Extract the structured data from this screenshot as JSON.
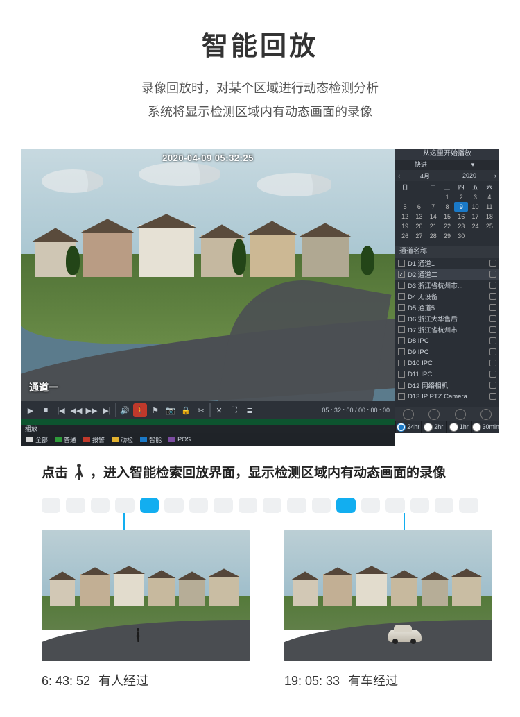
{
  "title": "智能回放",
  "subtitle_line1": "录像回放时，对某个区域进行动态检测分析",
  "subtitle_line2": "系统将显示检测区域内有动态画面的录像",
  "player": {
    "timestamp": "2020-04-09 05:32:25",
    "channel_overlay_label": "通道一",
    "playback_status": "播放",
    "time_readout": "05 : 32 : 00 / 00 : 00 : 00",
    "legend": {
      "all": "全部",
      "normal": "普通",
      "alarm": "报警",
      "motion": "动检",
      "smart": "智能",
      "pos": "POS"
    },
    "legend_colors": {
      "all": "#d8d8d8",
      "normal": "#2e9a3a",
      "alarm": "#c0392b",
      "motion": "#e3b22f",
      "smart": "#1a79c7",
      "pos": "#7b4ca0"
    }
  },
  "side_panel": {
    "header": "从这里开始播放",
    "tab_fast": "快进",
    "month_nav": {
      "prev": "‹",
      "month_label": "4月",
      "year_label": "2020",
      "next": "›"
    },
    "calendar": {
      "weekday_headers": [
        "日",
        "一",
        "二",
        "三",
        "四",
        "五",
        "六"
      ],
      "rows": [
        [
          "",
          "",
          "",
          "1",
          "2",
          "3",
          "4"
        ],
        [
          "5",
          "6",
          "7",
          "8",
          "9",
          "10",
          "11"
        ],
        [
          "12",
          "13",
          "14",
          "15",
          "16",
          "17",
          "18"
        ],
        [
          "19",
          "20",
          "21",
          "22",
          "23",
          "24",
          "25"
        ],
        [
          "26",
          "27",
          "28",
          "29",
          "30",
          "",
          ""
        ]
      ],
      "today": "9"
    },
    "channel_header": "通道名称",
    "channels": [
      {
        "id": "D1",
        "label": "D1 通道1",
        "checked": false
      },
      {
        "id": "D2",
        "label": "D2 通道二",
        "checked": true,
        "selected": true
      },
      {
        "id": "D3",
        "label": "D3 浙江省杭州市...",
        "checked": false
      },
      {
        "id": "D4",
        "label": "D4 无设备",
        "checked": false
      },
      {
        "id": "D5",
        "label": "D5 通道5",
        "checked": false
      },
      {
        "id": "D6",
        "label": "D6 浙江大华售后...",
        "checked": false
      },
      {
        "id": "D7",
        "label": "D7 浙江省杭州市...",
        "checked": false
      },
      {
        "id": "D8",
        "label": "D8 IPC",
        "checked": false
      },
      {
        "id": "D9",
        "label": "D9 IPC",
        "checked": false
      },
      {
        "id": "D10",
        "label": "D10 IPC",
        "checked": false
      },
      {
        "id": "D11",
        "label": "D11 IPC",
        "checked": false
      },
      {
        "id": "D12",
        "label": "D12 网络相机",
        "checked": false
      },
      {
        "id": "D13",
        "label": "D13 IP PTZ Camera",
        "checked": false
      }
    ],
    "range": {
      "r24": "24hr",
      "r2": "2hr",
      "r1": "1hr",
      "r30": "30min",
      "selected": "24hr"
    }
  },
  "instruction": {
    "prefix": "点击",
    "suffix": "，进入智能检索回放界面，显示检测区域内有动态画面的录像"
  },
  "timeline_segments": 18,
  "timeline_active_indices": [
    4,
    12
  ],
  "thumbs": [
    {
      "time": "6: 43: 52",
      "caption": "有人经过"
    },
    {
      "time": "19: 05: 33",
      "caption": "有车经过"
    }
  ]
}
